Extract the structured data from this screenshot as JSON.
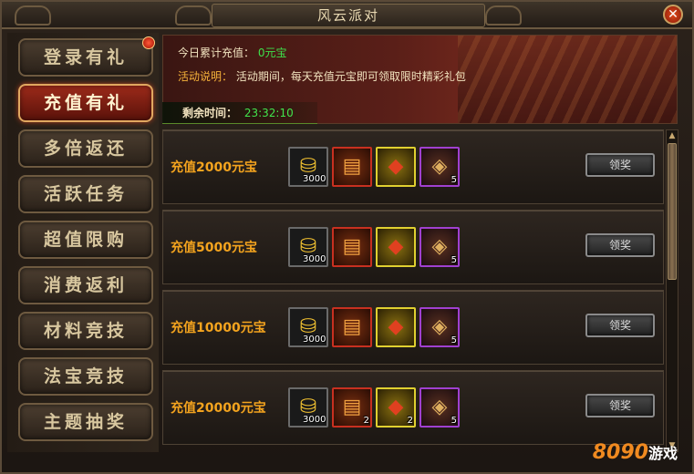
{
  "window": {
    "title": "风云派对",
    "close_label": "✕"
  },
  "sidebar": {
    "items": [
      {
        "label": "登录有礼",
        "badge": true
      },
      {
        "label": "充值有礼",
        "active": true
      },
      {
        "label": "多倍返还"
      },
      {
        "label": "活跃任务"
      },
      {
        "label": "超值限购"
      },
      {
        "label": "消费返利"
      },
      {
        "label": "材料竞技"
      },
      {
        "label": "法宝竞技"
      },
      {
        "label": "主题抽奖"
      }
    ]
  },
  "header": {
    "today_label": "今日累计充值：",
    "today_value": "0元宝",
    "desc_label": "活动说明：",
    "desc_text": "活动期间，每天充值元宝即可领取限时精彩礼包",
    "remaining_label": "剩余时间：",
    "remaining_value": "23:32:10"
  },
  "rewards": [
    {
      "title": "充值2000元宝",
      "items": [
        {
          "icon": "gold-ingot-icon",
          "count": "3000"
        },
        {
          "icon": "scroll-icon",
          "count": ""
        },
        {
          "icon": "red-pouch-icon",
          "count": ""
        },
        {
          "icon": "talisman-icon",
          "count": "5"
        }
      ],
      "button": "领奖"
    },
    {
      "title": "充值5000元宝",
      "items": [
        {
          "icon": "gold-ingot-icon",
          "count": "3000"
        },
        {
          "icon": "scroll-icon",
          "count": ""
        },
        {
          "icon": "red-pouch-icon",
          "count": ""
        },
        {
          "icon": "talisman-icon",
          "count": "5"
        }
      ],
      "button": "领奖"
    },
    {
      "title": "充值10000元宝",
      "items": [
        {
          "icon": "gold-ingot-icon",
          "count": "3000"
        },
        {
          "icon": "scroll-icon",
          "count": ""
        },
        {
          "icon": "red-pouch-icon",
          "count": ""
        },
        {
          "icon": "talisman-icon",
          "count": "5"
        }
      ],
      "button": "领奖"
    },
    {
      "title": "充值20000元宝",
      "items": [
        {
          "icon": "gold-ingot-icon",
          "count": "3000"
        },
        {
          "icon": "scroll-icon",
          "count": "2"
        },
        {
          "icon": "red-pouch-icon",
          "count": "2"
        },
        {
          "icon": "talisman-icon",
          "count": "5"
        }
      ],
      "button": "领奖"
    }
  ],
  "watermark": {
    "number": "8090",
    "text": "游戏"
  },
  "colors": {
    "accent_gold": "#f4a41e",
    "timer_green": "#42e44c",
    "active_red": "#9c2a1a"
  }
}
